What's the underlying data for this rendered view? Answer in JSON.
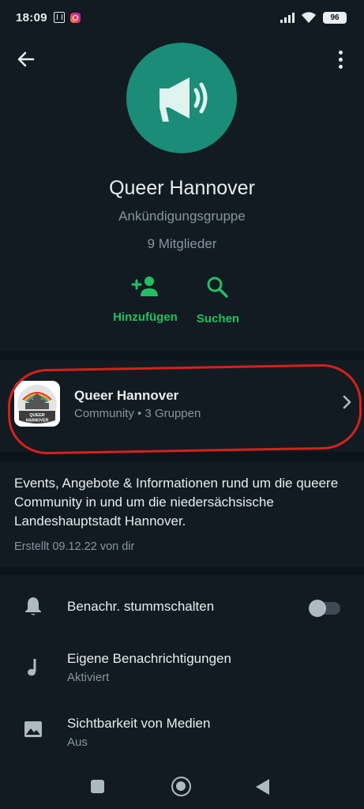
{
  "status_bar": {
    "time": "18:09",
    "battery": "96"
  },
  "header": {
    "group_name": "Queer Hannover",
    "group_type": "Ankündigungsgruppe",
    "members": "9 Mitglieder",
    "actions": [
      {
        "label": "Hinzufügen",
        "icon": "add-person-icon"
      },
      {
        "label": "Suchen",
        "icon": "search-icon"
      }
    ]
  },
  "community": {
    "name": "Queer Hannover",
    "subtitle": "Community • 3 Gruppen",
    "logo_text": "QUEER HANNOVER"
  },
  "description": {
    "text": "Events, Angebote & Informationen rund um die queere Community in und um die niedersächsische Landeshauptstadt Hannover.",
    "created": "Erstellt 09.12.22 von dir"
  },
  "settings": [
    {
      "title": "Benachr. stummschalten",
      "icon": "bell-icon",
      "toggle": false
    },
    {
      "title": "Eigene Benachrichtigungen",
      "subtitle": "Aktiviert",
      "icon": "music-note-icon"
    },
    {
      "title": "Sichtbarkeit von Medien",
      "subtitle": "Aus",
      "icon": "image-icon"
    }
  ],
  "colors": {
    "background": "#0b141a",
    "surface": "#111b21",
    "accent": "#21c063",
    "avatar": "#1a8c78",
    "highlight_ring": "#d8201b"
  }
}
